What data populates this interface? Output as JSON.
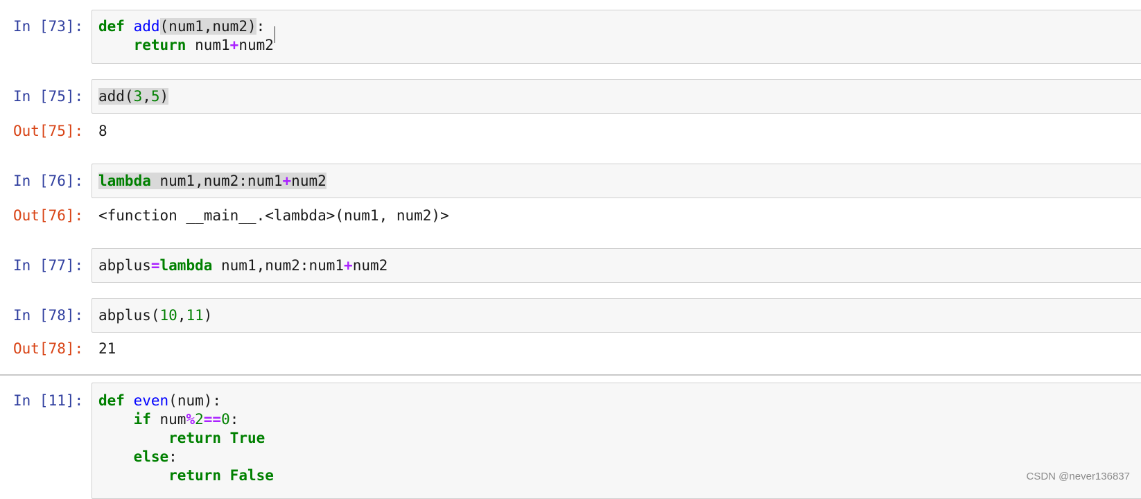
{
  "cells": [
    {
      "prompt": "In [73]:",
      "lines": [
        [
          {
            "t": "def",
            "c": "kw"
          },
          {
            "t": " "
          },
          {
            "t": "add",
            "c": "fn"
          },
          {
            "t": "(num1,num2)",
            "c": "hl"
          },
          {
            "t": ":"
          }
        ],
        [
          {
            "t": "    "
          },
          {
            "t": "return",
            "c": "kw"
          },
          {
            "t": " num1"
          },
          {
            "t": "+",
            "c": "op"
          },
          {
            "t": "num2"
          }
        ]
      ]
    },
    {
      "prompt": "In [75]:",
      "lines": [
        [
          {
            "t": "add(",
            "c": "hl"
          },
          {
            "t": "3",
            "c": "num hl"
          },
          {
            "t": ",",
            "c": "hl"
          },
          {
            "t": "5",
            "c": "num hl"
          },
          {
            "t": ")",
            "c": "hl"
          }
        ]
      ],
      "out_prompt": "Out[75]:",
      "output": "8"
    },
    {
      "prompt": "In [76]:",
      "lines": [
        [
          {
            "t": "lambda",
            "c": "kw hl"
          },
          {
            "t": " num1,num2:num1",
            "c": "hl"
          },
          {
            "t": "+",
            "c": "op hl"
          },
          {
            "t": "num2",
            "c": "hl"
          }
        ]
      ],
      "out_prompt": "Out[76]:",
      "output": "<function __main__.<lambda>(num1, num2)>"
    },
    {
      "prompt": "In [77]:",
      "lines": [
        [
          {
            "t": "abplus"
          },
          {
            "t": "=",
            "c": "op"
          },
          {
            "t": "lambda",
            "c": "kw"
          },
          {
            "t": " num1,num2:num1"
          },
          {
            "t": "+",
            "c": "op"
          },
          {
            "t": "num2"
          }
        ]
      ]
    },
    {
      "prompt": "In [78]:",
      "lines": [
        [
          {
            "t": "abplus("
          },
          {
            "t": "10",
            "c": "num"
          },
          {
            "t": ","
          },
          {
            "t": "11",
            "c": "num"
          },
          {
            "t": ")"
          }
        ]
      ],
      "out_prompt": "Out[78]:",
      "output": "21"
    },
    {
      "prompt": "In [11]:",
      "lines": [
        [
          {
            "t": "def",
            "c": "kw"
          },
          {
            "t": " "
          },
          {
            "t": "even",
            "c": "fn"
          },
          {
            "t": "(num):"
          }
        ],
        [
          {
            "t": "    "
          },
          {
            "t": "if",
            "c": "kw"
          },
          {
            "t": " num"
          },
          {
            "t": "%",
            "c": "op"
          },
          {
            "t": "2",
            "c": "num"
          },
          {
            "t": "==",
            "c": "op"
          },
          {
            "t": "0",
            "c": "num"
          },
          {
            "t": ":"
          }
        ],
        [
          {
            "t": "        "
          },
          {
            "t": "return",
            "c": "kw"
          },
          {
            "t": " "
          },
          {
            "t": "True",
            "c": "kw"
          }
        ],
        [
          {
            "t": "    "
          },
          {
            "t": "else",
            "c": "kw"
          },
          {
            "t": ":"
          }
        ],
        [
          {
            "t": "        "
          },
          {
            "t": "return",
            "c": "kw"
          },
          {
            "t": " "
          },
          {
            "t": "False",
            "c": "kw"
          }
        ]
      ]
    }
  ],
  "watermark": "CSDN @never136837"
}
